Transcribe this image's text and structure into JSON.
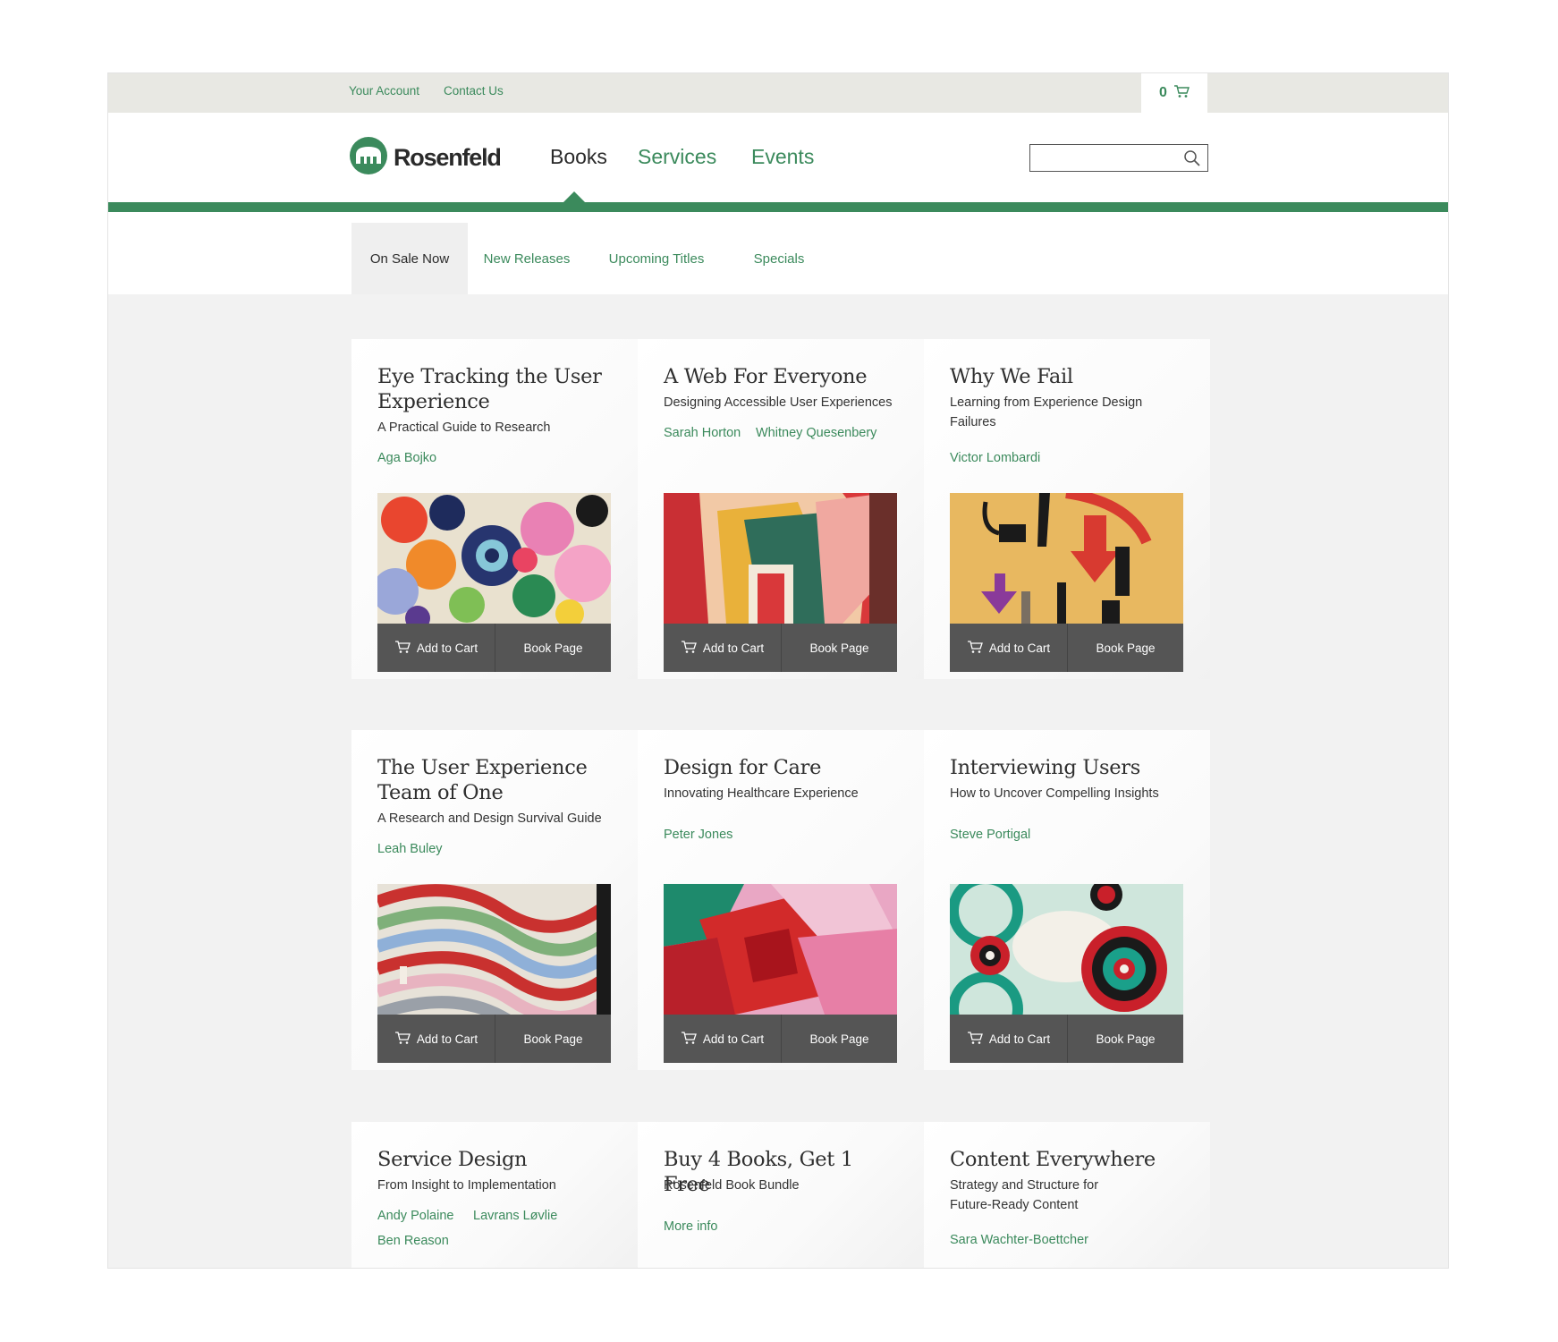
{
  "utility": {
    "your_account": "Your Account",
    "contact_us": "Contact Us",
    "cart_count": "0"
  },
  "brand": {
    "name": "Rosenfeld"
  },
  "nav": {
    "books": "Books",
    "services": "Services",
    "events": "Events"
  },
  "search": {
    "placeholder": ""
  },
  "subnav": {
    "on_sale_now": "On Sale Now",
    "new_releases": "New Releases",
    "upcoming_titles": "Upcoming Titles",
    "specials": "Specials"
  },
  "actions": {
    "add_to_cart": "Add to Cart",
    "book_page": "Book Page"
  },
  "books": [
    {
      "title": "Eye Tracking the User Experience",
      "subtitle": "A Practical Guide to Research",
      "authors": [
        "Aga Bojko"
      ]
    },
    {
      "title": "A Web For Everyone",
      "subtitle": "Designing Accessible User Experiences",
      "authors": [
        "Sarah Horton",
        "Whitney Quesenbery"
      ]
    },
    {
      "title": "Why We Fail",
      "subtitle": "Learning from Experience Design Failures",
      "authors": [
        "Victor Lombardi"
      ]
    },
    {
      "title": "The User Experience Team of One",
      "subtitle": "A Research and Design Survival Guide",
      "authors": [
        "Leah Buley"
      ]
    },
    {
      "title": "Design for Care",
      "subtitle": "Innovating Healthcare Experience",
      "authors": [
        "Peter Jones"
      ]
    },
    {
      "title": "Interviewing Users",
      "subtitle": "How to Uncover Compelling Insights",
      "authors": [
        "Steve Portigal"
      ]
    },
    {
      "title": "Service Design",
      "subtitle": "From Insight to Implementation",
      "authors": [
        "Andy Polaine",
        "Lavrans Løvlie",
        "Ben Reason"
      ]
    },
    {
      "title": "Buy 4 Books, Get 1 Free",
      "subtitle": "Rosenfeld Book Bundle",
      "link": "More info"
    },
    {
      "title": "Content Everywhere",
      "subtitle": "Strategy and Structure for Future-Ready Content",
      "authors": [
        "Sara Wachter-Boettcher"
      ]
    }
  ],
  "colors": {
    "accent": "#3b8a5c",
    "action_bar": "#555555",
    "utility_bar": "#e8e8e3"
  }
}
